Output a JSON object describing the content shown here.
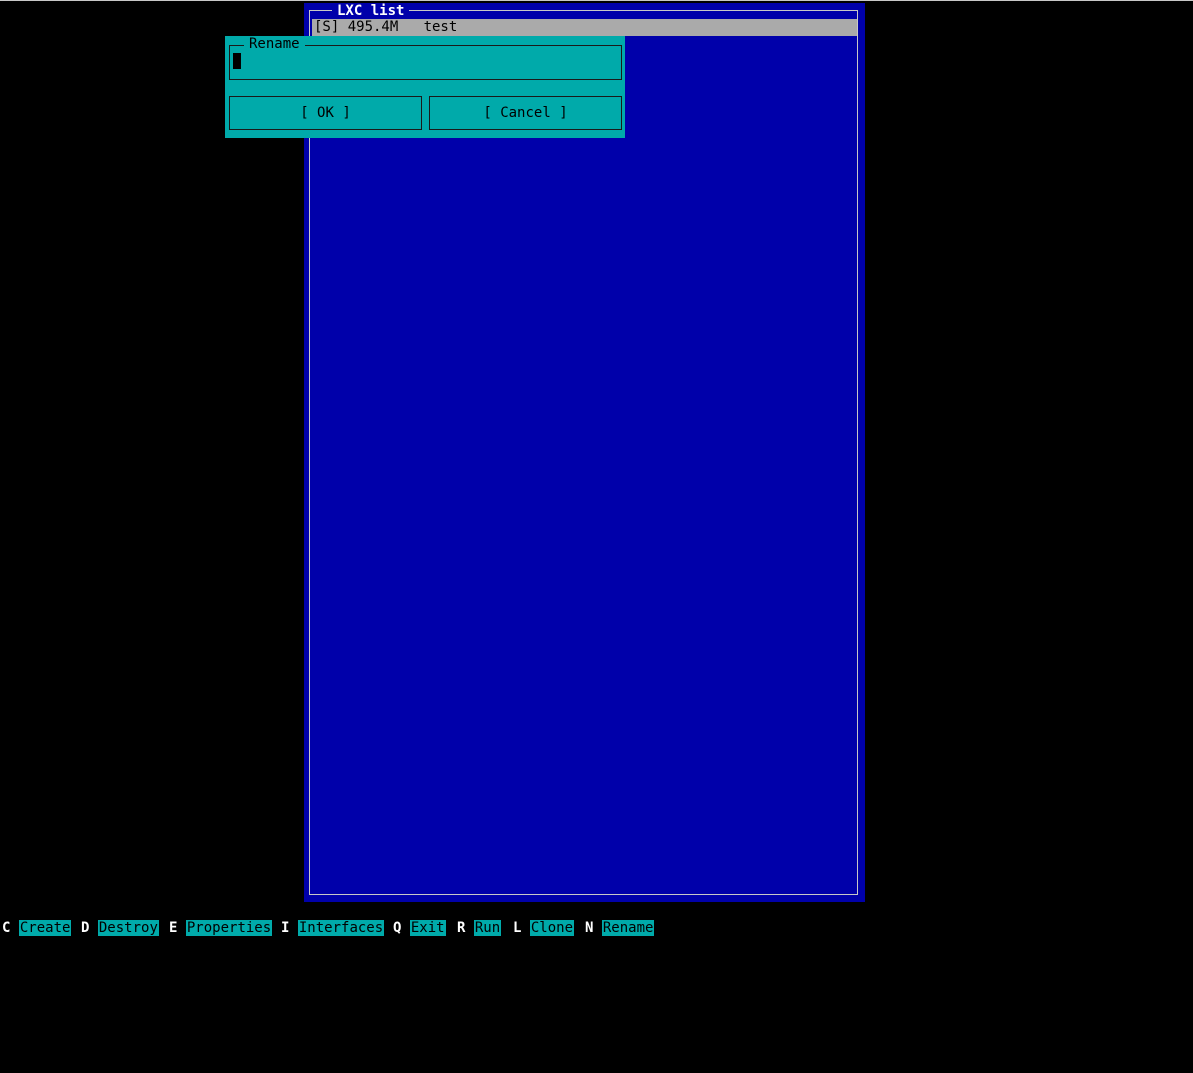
{
  "list_panel": {
    "title": "LXC list",
    "items": [
      {
        "text": "[S] 495.4M   test"
      }
    ]
  },
  "rename_dialog": {
    "label": "Rename",
    "input_value": "",
    "ok_label": "[ OK ]",
    "cancel_label": "[ Cancel ]"
  },
  "hotkeys": [
    {
      "key": "C",
      "label": "Create"
    },
    {
      "key": "D",
      "label": "Destroy"
    },
    {
      "key": "E",
      "label": "Properties"
    },
    {
      "key": "I",
      "label": "Interfaces"
    },
    {
      "key": "Q",
      "label": "Exit"
    },
    {
      "key": "R",
      "label": "Run"
    },
    {
      "key": "L",
      "label": "Clone"
    },
    {
      "key": "N",
      "label": "Rename"
    }
  ],
  "colors": {
    "background": "#000000",
    "panel": "#0000aa",
    "dialog": "#00aaaa",
    "selection": "#aaaaaa"
  }
}
